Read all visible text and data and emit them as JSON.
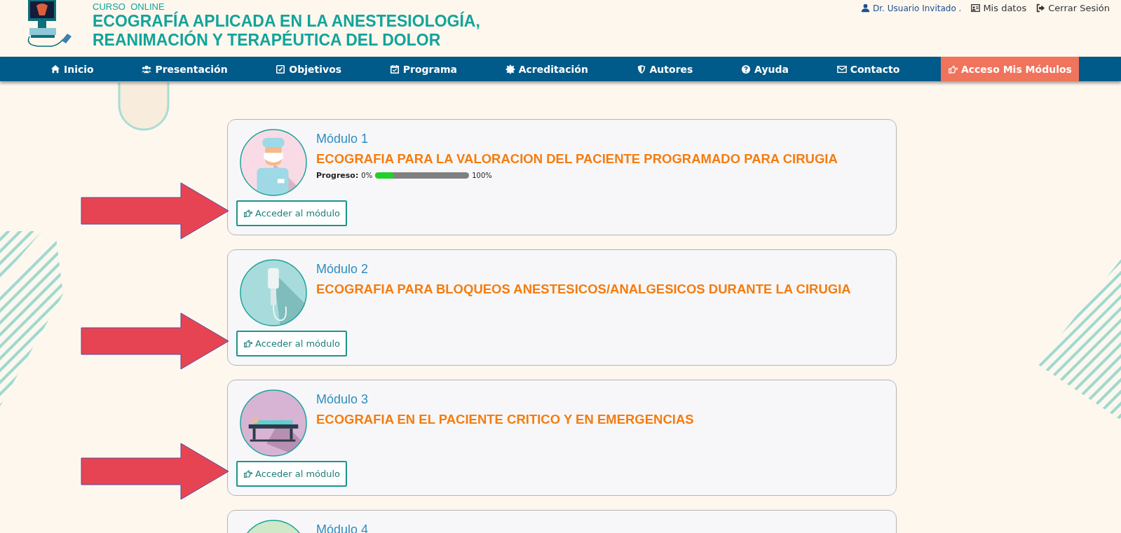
{
  "header": {
    "kicker": "CURSO  ONLINE",
    "title_lines": [
      "ECOGRAFÍA APLICADA EN LA ANESTESIOLOGÍA,",
      "REANIMACIÓN Y TERAPÉUTICA DEL DOLOR"
    ],
    "user_links": [
      {
        "kind": "user",
        "label": "Dr. Usuario Invitado ."
      },
      {
        "kind": "card",
        "label": "Mis datos"
      },
      {
        "kind": "logout",
        "label": "Cerrar Sesión"
      }
    ]
  },
  "nav": [
    {
      "kind": "home",
      "label": "Inicio",
      "selected": false
    },
    {
      "kind": "users",
      "label": "Presentación",
      "selected": false
    },
    {
      "kind": "check",
      "label": "Objetivos",
      "selected": false
    },
    {
      "kind": "calendar",
      "label": "Programa",
      "selected": false
    },
    {
      "kind": "badge",
      "label": "Acreditación",
      "selected": false
    },
    {
      "kind": "shield",
      "label": "Autores",
      "selected": false
    },
    {
      "kind": "help",
      "label": "Ayuda",
      "selected": false
    },
    {
      "kind": "mail",
      "label": "Contacto",
      "selected": false
    },
    {
      "kind": "hand",
      "label": "Acceso Mis Módulos",
      "selected": true
    }
  ],
  "modules": [
    {
      "kind": "surgeon",
      "label": "Módulo 1",
      "title": "ECOGRAFIA PARA LA VALORACION DEL PACIENTE PROGRAMADO PARA CIRUGIA",
      "progress": {
        "label": "Progreso:",
        "start": "0%",
        "end": "100%",
        "level": 0.2
      },
      "button": "Acceder al módulo"
    },
    {
      "kind": "drip",
      "label": "Módulo 2",
      "title": "ECOGRAFIA PARA BLOQUEOS ANESTESICOS/ANALGESICOS DURANTE LA CIRUGIA",
      "button": "Acceder al módulo"
    },
    {
      "kind": "stretcher",
      "label": "Módulo 3",
      "title": "ECOGRAFIA EN EL PACIENTE CRITICO Y EN EMERGENCIAS",
      "button": "Acceder al módulo"
    },
    {
      "kind": "partial",
      "label": "Módulo 4"
    }
  ]
}
